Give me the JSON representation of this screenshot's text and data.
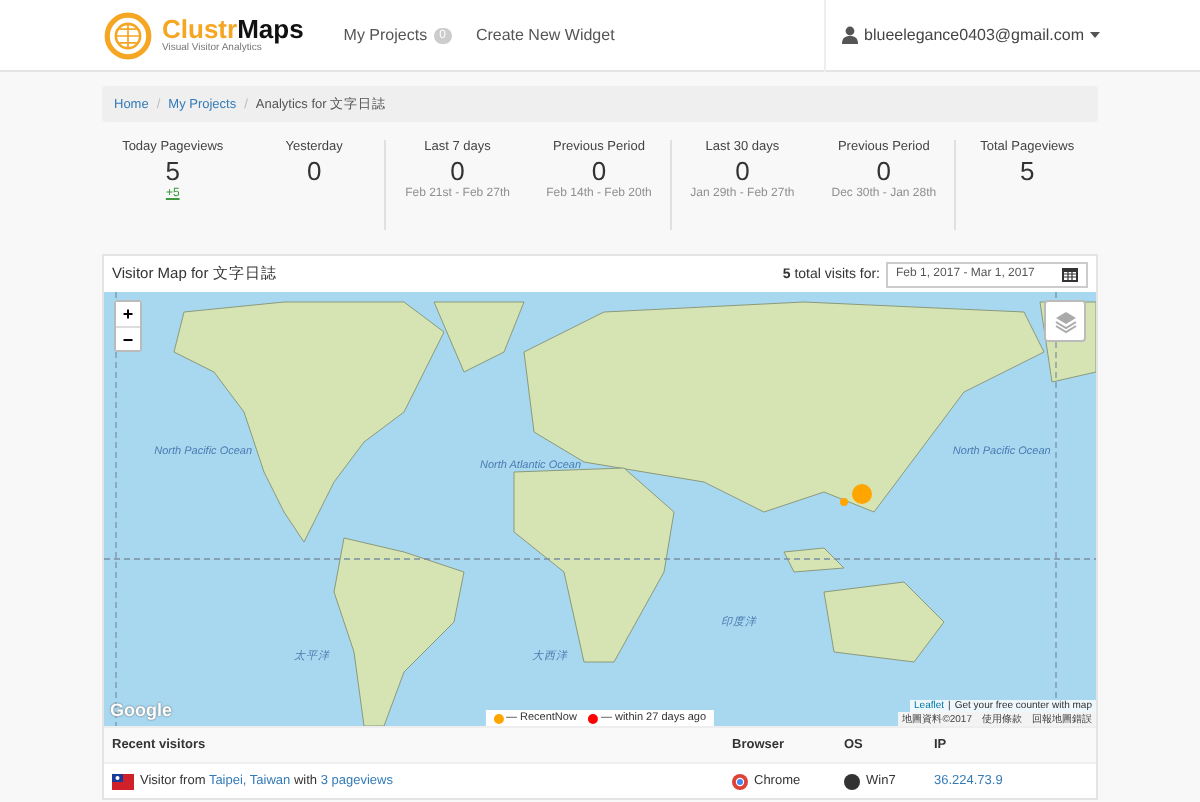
{
  "header": {
    "brand_first": "Clustr",
    "brand_second": "Maps",
    "tagline": "Visual Visitor Analytics",
    "nav": [
      {
        "label": "My Projects",
        "badge": "0"
      },
      {
        "label": "Create New Widget"
      }
    ],
    "user": "blueelegance0403@gmail.com"
  },
  "breadcrumb": [
    {
      "label": "Home",
      "link": true
    },
    {
      "separator_before": "/",
      "label": "My Projects",
      "link": true
    },
    {
      "separator_before": "/",
      "label": "Analytics for 文字日誌",
      "link": false
    }
  ],
  "stats": [
    [
      {
        "label": "Today Pageviews",
        "value": "5",
        "delta": "+5"
      },
      {
        "label": "Yesterday",
        "value": "0"
      }
    ],
    [
      {
        "label": "Last 7 days",
        "value": "0",
        "range": "Feb 21st - Feb 27th"
      },
      {
        "label": "Previous Period",
        "value": "0",
        "range": "Feb 14th - Feb 20th"
      }
    ],
    [
      {
        "label": "Last 30 days",
        "value": "0",
        "range": "Jan 29th - Feb 27th"
      },
      {
        "label": "Previous Period",
        "value": "0",
        "range": "Dec 30th - Jan 28th"
      }
    ],
    [
      {
        "label": "Total Pageviews",
        "value": "5"
      }
    ]
  ],
  "map_panel": {
    "title": "Visitor Map for 文字日誌",
    "total": "5",
    "total_label": "total visits for:",
    "date_range": "Feb 1, 2017 - Mar 1, 2017",
    "zoom_in": "+",
    "zoom_out": "−",
    "ocean_labels": [
      "North Pacific Ocean",
      "North Atlantic Ocean",
      "North Pacific Ocean",
      "太平洋",
      "大西洋",
      "印度洋"
    ],
    "markers": [
      {
        "kind": "large",
        "color": "#ffa500"
      },
      {
        "kind": "small",
        "color": "#ffa500"
      }
    ],
    "attribution": [
      {
        "text": "Leaflet",
        "link": true
      },
      {
        "separator_before": "|",
        "text": "Get your free counter with map",
        "link": false
      }
    ],
    "provider": "Google",
    "map_terms": [
      "地圖資料©2017",
      "使用條款",
      "回報地圖錯誤"
    ],
    "legend": [
      {
        "label": "— RecentNow",
        "color": "#ffa500"
      },
      {
        "label": "— within 27 days ago",
        "color": "#ff0000"
      }
    ]
  },
  "visitors": {
    "columns": [
      "Recent visitors",
      "Browser",
      "OS",
      "IP"
    ],
    "rows": [
      {
        "prefix": "Visitor from",
        "place": "Taipei, Taiwan",
        "middle": "with",
        "pageviews": "3 pageviews",
        "browser": "Chrome",
        "os": "Win7",
        "ip": "36.224.73.9"
      }
    ]
  }
}
